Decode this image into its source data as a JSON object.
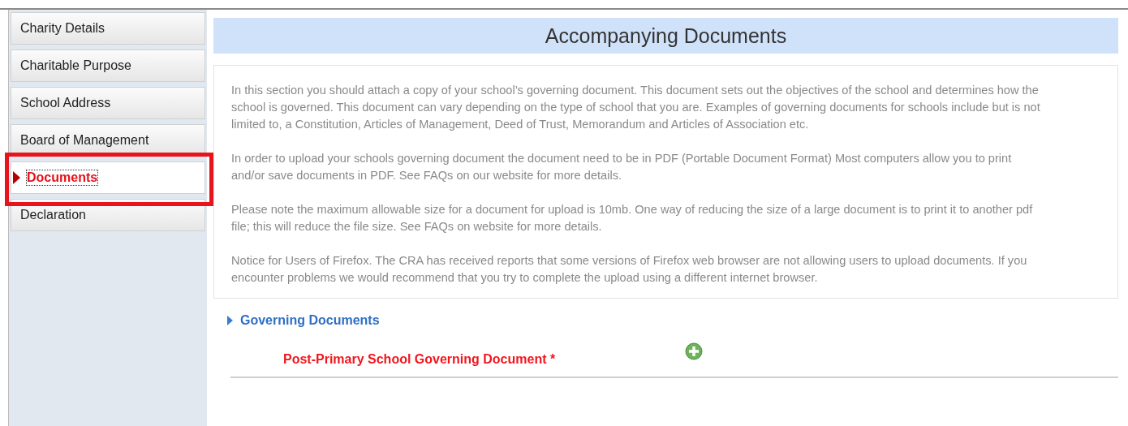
{
  "sidebar": {
    "items": [
      {
        "label": "Charity Details",
        "selected": false
      },
      {
        "label": "Charitable Purpose",
        "selected": false
      },
      {
        "label": "School Address",
        "selected": false
      },
      {
        "label": "Board of Management",
        "selected": false
      },
      {
        "label": "Documents",
        "selected": true
      },
      {
        "label": "Declaration",
        "selected": false
      }
    ]
  },
  "page_title": "Accompanying Documents",
  "paragraphs": [
    "In this section you should attach a copy of your school’s governing document. This document sets out the objectives of the school and determines how the school is governed. This document can vary depending on the type of school that you are. Examples of governing documents for schools include but is not limited to, a Constitution, Articles of Management, Deed of Trust, Memorandum and Articles of Association etc.",
    "In order to upload your schools governing document the document need to be in PDF (Portable Document Format) Most computers allow you to print and/or save documents in PDF. See FAQs on our website for more details.",
    "Please note the maximum allowable size for a document for upload is 10mb. One way of reducing the size of a large document is to print it to another pdf file; this will reduce the file size. See FAQs on website for more details.",
    "Notice for Users of Firefox. The CRA has received reports that some versions of Firefox web browser are not allowing users to upload documents. If you encounter problems we would recommend that you try to complete the upload using a different internet browser."
  ],
  "section": {
    "title": "Governing Documents",
    "expanded": false,
    "fields": [
      {
        "label": "Post-Primary School Governing Document *",
        "required": true
      }
    ]
  }
}
